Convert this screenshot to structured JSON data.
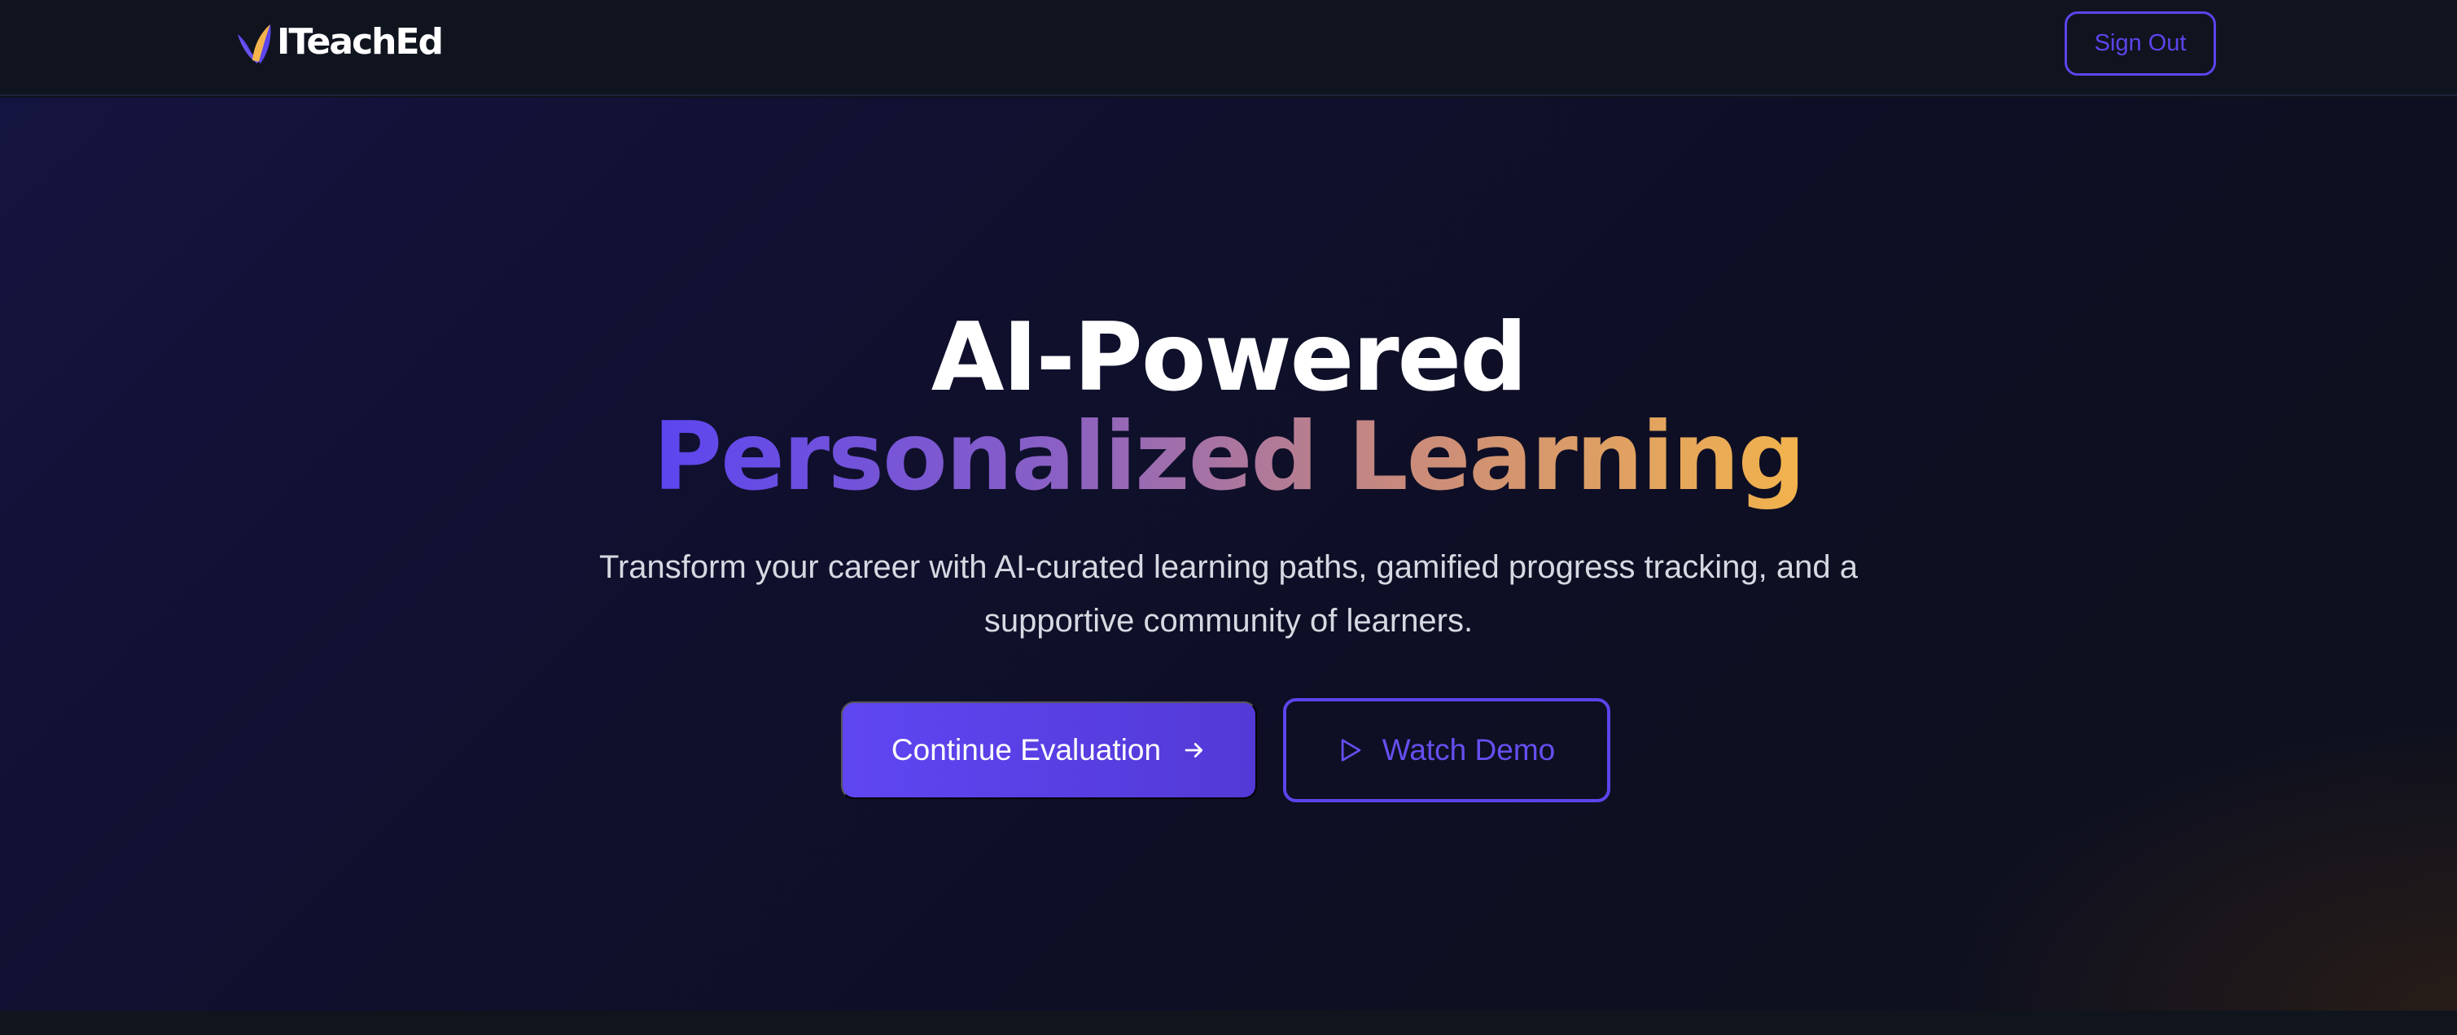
{
  "brand": {
    "name": "ITeachEd",
    "logo_icon": "leaf-book-icon",
    "logo_colors": [
      "#5b45ec",
      "#f2b34c"
    ]
  },
  "nav": {
    "signout_label": "Sign Out"
  },
  "hero": {
    "headline": "AI-Powered",
    "headline_accent": "Personalized Learning",
    "subtitle": "Transform your career with AI-curated learning paths, gamified progress tracking, and a supportive community of learners.",
    "primary_button": {
      "label": "Continue Evaluation",
      "icon": "arrow-right-icon"
    },
    "secondary_button": {
      "label": "Watch Demo",
      "icon": "play-icon"
    }
  },
  "colors": {
    "accent": "#5b45ec",
    "accent_gradient_end": "#f2b34c",
    "navbar_bg": "#10141f",
    "text_primary": "#ffffff",
    "text_secondary": "#d7d9e2"
  }
}
